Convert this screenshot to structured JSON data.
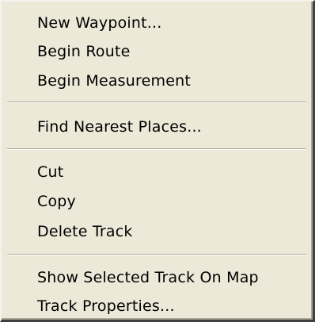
{
  "context_menu": {
    "groups": [
      {
        "items": [
          {
            "label": "New Waypoint..."
          },
          {
            "label": "Begin Route"
          },
          {
            "label": "Begin Measurement"
          }
        ]
      },
      {
        "items": [
          {
            "label": "Find Nearest Places..."
          }
        ]
      },
      {
        "items": [
          {
            "label": "Cut"
          },
          {
            "label": "Copy"
          },
          {
            "label": "Delete Track"
          }
        ]
      },
      {
        "items": [
          {
            "label": "Show Selected Track On Map"
          },
          {
            "label": "Track Properties..."
          }
        ]
      }
    ]
  }
}
